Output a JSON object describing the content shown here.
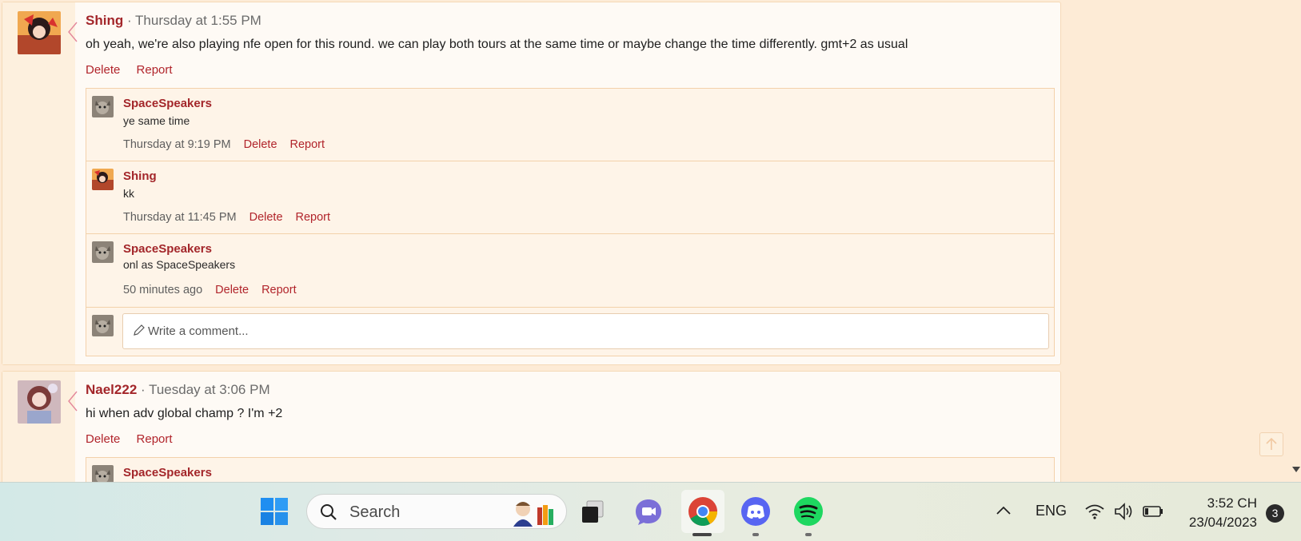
{
  "posts": [
    {
      "author": "Shing",
      "time": "· Thursday at 1:55 PM",
      "text": "oh yeah, we're also playing nfe open for this round. we can play both tours at the same time or maybe change the time differently. gmt+2 as usual",
      "actions": {
        "delete": "Delete",
        "report": "Report"
      },
      "replies": [
        {
          "author": "SpaceSpeakers",
          "text": "ye same time",
          "time": "Thursday at 9:19 PM",
          "delete": "Delete",
          "report": "Report"
        },
        {
          "author": "Shing",
          "text": "kk",
          "time": "Thursday at 11:45 PM",
          "delete": "Delete",
          "report": "Report"
        },
        {
          "author": "SpaceSpeakers",
          "text": "onl as SpaceSpeakers",
          "time": "50 minutes ago",
          "delete": "Delete",
          "report": "Report"
        }
      ],
      "comment_placeholder": "Write a comment..."
    },
    {
      "author": "Nael222",
      "time": "· Tuesday at 3:06 PM",
      "text": "hi when adv global champ ? I'm +2",
      "actions": {
        "delete": "Delete",
        "report": "Report"
      },
      "replies": [
        {
          "author": "SpaceSpeakers"
        }
      ]
    }
  ],
  "taskbar": {
    "search_label": "Search",
    "language": "ENG",
    "time": "3:52 CH",
    "date": "23/04/2023",
    "notification_count": "3",
    "apps": [
      "windows-start",
      "search",
      "task-view",
      "teams-chat",
      "chrome",
      "discord",
      "spotify"
    ]
  },
  "colors": {
    "accent": "#a3262a",
    "page_bg": "#fdebd6",
    "post_bg": "#fefaf5"
  }
}
